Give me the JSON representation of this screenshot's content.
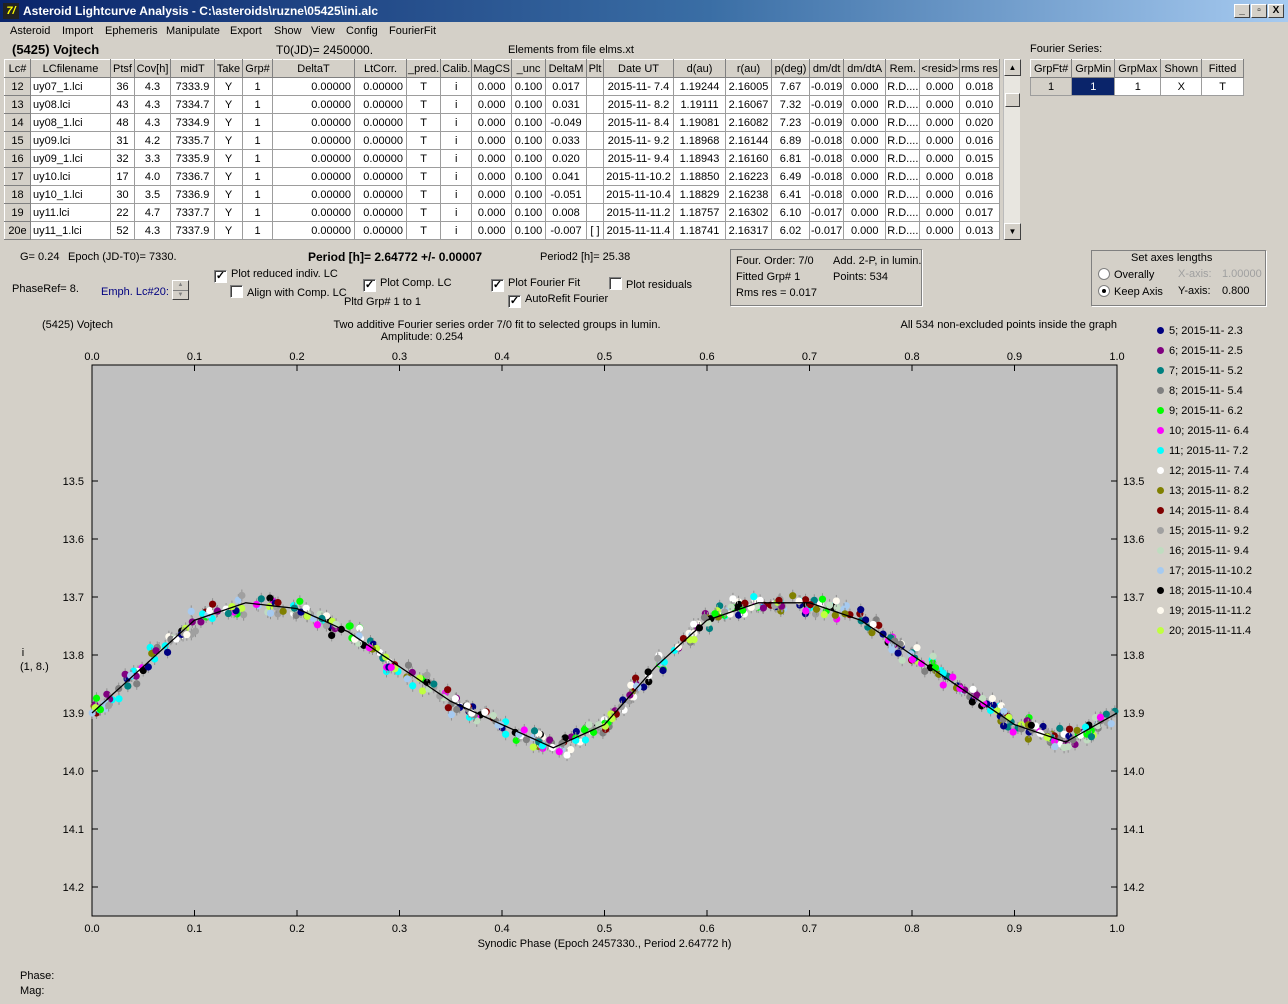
{
  "window": {
    "title": "Asteroid Lightcurve Analysis - C:\\asteroids\\ruzne\\05425\\ini.alc",
    "logo": "7/"
  },
  "window_buttons": {
    "minimize": "_",
    "restore": "▫",
    "close": "X"
  },
  "menu": [
    "Asteroid",
    "Import",
    "Ephemeris",
    "Manipulate",
    "Export",
    "Show",
    "View",
    "Config",
    "FourierFit"
  ],
  "header": {
    "asteroid": "(5425) Vojtech",
    "t0": "T0(JD)= 2450000.",
    "elements": "Elements from file elms.xt",
    "fourier_series": "Fourier Series:"
  },
  "table": {
    "columns": [
      "Lc#",
      "LCfilename",
      "Ptsf",
      "Cov[h]",
      "midT",
      "Take",
      "Grp#",
      "DeltaT",
      "LtCorr.",
      "_pred.",
      "Calib.",
      "MagCS",
      "_unc",
      "DeltaM",
      "Plt",
      "Date UT",
      "d(au)",
      "r(au)",
      "p(deg)",
      "dm/dt",
      "dm/dtA",
      "Rem.",
      "<resid>",
      "rms res"
    ],
    "rows": [
      [
        "12",
        "uy07_1.lci",
        "36",
        "4.3",
        "7333.9",
        "Y",
        "1",
        "0.00000",
        "0.00000",
        "T",
        "i",
        "0.000",
        "0.100",
        "0.017",
        "",
        "2015-11- 7.4",
        "1.19244",
        "2.16005",
        "7.67",
        "-0.019",
        "0.000",
        "R.D....",
        "0.000",
        "0.018"
      ],
      [
        "13",
        "uy08.lci",
        "43",
        "4.3",
        "7334.7",
        "Y",
        "1",
        "0.00000",
        "0.00000",
        "T",
        "i",
        "0.000",
        "0.100",
        "0.031",
        "",
        "2015-11- 8.2",
        "1.19111",
        "2.16067",
        "7.32",
        "-0.019",
        "0.000",
        "R.D....",
        "0.000",
        "0.010"
      ],
      [
        "14",
        "uy08_1.lci",
        "48",
        "4.3",
        "7334.9",
        "Y",
        "1",
        "0.00000",
        "0.00000",
        "T",
        "i",
        "0.000",
        "0.100",
        "-0.049",
        "",
        "2015-11- 8.4",
        "1.19081",
        "2.16082",
        "7.23",
        "-0.019",
        "0.000",
        "R.D....",
        "0.000",
        "0.020"
      ],
      [
        "15",
        "uy09.lci",
        "31",
        "4.2",
        "7335.7",
        "Y",
        "1",
        "0.00000",
        "0.00000",
        "T",
        "i",
        "0.000",
        "0.100",
        "0.033",
        "",
        "2015-11- 9.2",
        "1.18968",
        "2.16144",
        "6.89",
        "-0.018",
        "0.000",
        "R.D....",
        "0.000",
        "0.016"
      ],
      [
        "16",
        "uy09_1.lci",
        "32",
        "3.3",
        "7335.9",
        "Y",
        "1",
        "0.00000",
        "0.00000",
        "T",
        "i",
        "0.000",
        "0.100",
        "0.020",
        "",
        "2015-11- 9.4",
        "1.18943",
        "2.16160",
        "6.81",
        "-0.018",
        "0.000",
        "R.D....",
        "0.000",
        "0.015"
      ],
      [
        "17",
        "uy10.lci",
        "17",
        "4.0",
        "7336.7",
        "Y",
        "1",
        "0.00000",
        "0.00000",
        "T",
        "i",
        "0.000",
        "0.100",
        "0.041",
        "",
        "2015-11-10.2",
        "1.18850",
        "2.16223",
        "6.49",
        "-0.018",
        "0.000",
        "R.D....",
        "0.000",
        "0.018"
      ],
      [
        "18",
        "uy10_1.lci",
        "30",
        "3.5",
        "7336.9",
        "Y",
        "1",
        "0.00000",
        "0.00000",
        "T",
        "i",
        "0.000",
        "0.100",
        "-0.051",
        "",
        "2015-11-10.4",
        "1.18829",
        "2.16238",
        "6.41",
        "-0.018",
        "0.000",
        "R.D....",
        "0.000",
        "0.016"
      ],
      [
        "19",
        "uy11.lci",
        "22",
        "4.7",
        "7337.7",
        "Y",
        "1",
        "0.00000",
        "0.00000",
        "T",
        "i",
        "0.000",
        "0.100",
        "0.008",
        "",
        "2015-11-11.2",
        "1.18757",
        "2.16302",
        "6.10",
        "-0.017",
        "0.000",
        "R.D....",
        "0.000",
        "0.017"
      ],
      [
        "20e",
        "uy11_1.lci",
        "52",
        "4.3",
        "7337.9",
        "Y",
        "1",
        "0.00000",
        "0.00000",
        "T",
        "i",
        "0.000",
        "0.100",
        "-0.007",
        "[ ]",
        "2015-11-11.4",
        "1.18741",
        "2.16317",
        "6.02",
        "-0.017",
        "0.000",
        "R.D....",
        "0.000",
        "0.013"
      ]
    ]
  },
  "fourier_table": {
    "columns": [
      "GrpFt#",
      "GrpMin",
      "GrpMax",
      "Shown",
      "Fitted"
    ],
    "row": [
      "1",
      "1",
      "1",
      "X",
      "T"
    ]
  },
  "info": {
    "g": "G= 0.24",
    "epoch": "Epoch (JD-T0)= 7330.",
    "period": "Period [h]= 2.64772 +/- 0.00007",
    "period2": "Period2 [h]= 25.38",
    "phaseref": "PhaseRef= 8.",
    "emph": "Emph. Lc#20:",
    "pltd_grp": "Pltd Grp#  1   to   1"
  },
  "checks": {
    "plot_reduced": "Plot reduced indiv. LC",
    "align_comp": "Align with Comp. LC",
    "plot_comp": "Plot Comp. LC",
    "plot_fourier": "Plot Fourier Fit",
    "autorefit": "AutoRefit Fourier",
    "plot_residuals": "Plot residuals",
    "check_mark": "✓"
  },
  "fourier_info": {
    "order": "Four. Order:  7/0",
    "add": "Add. 2-P, in lumin.",
    "fitted": "Fitted Grp# 1",
    "points": "Points: 534",
    "rms": "Rms res     = 0.017"
  },
  "axes_box": {
    "title": "Set axes lengths",
    "overally": "Overally",
    "keep": "Keep Axis",
    "xaxis_label": "X-axis:",
    "xaxis_val": "1.00000",
    "yaxis_label": "Y-axis:",
    "yaxis_val": "0.800"
  },
  "status": {
    "phase": "Phase:",
    "mag": "Mag:"
  },
  "chart_data": {
    "type": "scatter",
    "title": "Two additive Fourier series order 7/0 fit to selected groups in lumin.",
    "subtitle": "Amplitude: 0.254",
    "corner_left": "(5425) Vojtech",
    "corner_right": "All 534 non-excluded points inside the graph",
    "xlabel": "Synodic Phase (Epoch 2457330., Period 2.64772 h)",
    "ylabel": "i",
    "ylabel2": "(1, 8.)",
    "xlim": [
      0,
      1
    ],
    "ylim": [
      14.25,
      13.3
    ],
    "xticks": [
      "0.0",
      "0.1",
      "0.2",
      "0.3",
      "0.4",
      "0.5",
      "0.6",
      "0.7",
      "0.8",
      "0.9",
      "1.0"
    ],
    "yticks": [
      "13.5",
      "13.6",
      "13.7",
      "13.8",
      "13.9",
      "14.0",
      "14.1",
      "14.2"
    ],
    "fit_curve": {
      "x": [
        0,
        0.05,
        0.1,
        0.15,
        0.2,
        0.25,
        0.3,
        0.35,
        0.4,
        0.45,
        0.5,
        0.55,
        0.6,
        0.65,
        0.7,
        0.75,
        0.8,
        0.85,
        0.9,
        0.95,
        1.0
      ],
      "y": [
        13.9,
        13.82,
        13.74,
        13.71,
        13.72,
        13.76,
        13.82,
        13.88,
        13.92,
        13.96,
        13.92,
        13.82,
        13.74,
        13.71,
        13.71,
        13.74,
        13.8,
        13.86,
        13.92,
        13.95,
        13.9
      ]
    },
    "series": [
      {
        "name": "5; 2015-11- 2.3",
        "color": "#000080"
      },
      {
        "name": "6; 2015-11- 2.5",
        "color": "#800080"
      },
      {
        "name": "7; 2015-11- 5.2",
        "color": "#008080"
      },
      {
        "name": "8; 2015-11- 5.4",
        "color": "#808080"
      },
      {
        "name": "9; 2015-11- 6.2",
        "color": "#00ff00"
      },
      {
        "name": "10; 2015-11- 6.4",
        "color": "#ff00ff"
      },
      {
        "name": "11; 2015-11- 7.2",
        "color": "#00ffff"
      },
      {
        "name": "12; 2015-11- 7.4",
        "color": "#ffffff"
      },
      {
        "name": "13; 2015-11- 8.2",
        "color": "#808000"
      },
      {
        "name": "14; 2015-11- 8.4",
        "color": "#800000"
      },
      {
        "name": "15; 2015-11- 9.2",
        "color": "#a0a0a0"
      },
      {
        "name": "16; 2015-11- 9.4",
        "color": "#c0dcc0"
      },
      {
        "name": "17; 2015-11-10.2",
        "color": "#a6caf0"
      },
      {
        "name": "18; 2015-11-10.4",
        "color": "#000000"
      },
      {
        "name": "19; 2015-11-11.2",
        "color": "#fffbf0"
      },
      {
        "name": "20; 2015-11-11.4",
        "color": "#c0ff40"
      }
    ]
  }
}
